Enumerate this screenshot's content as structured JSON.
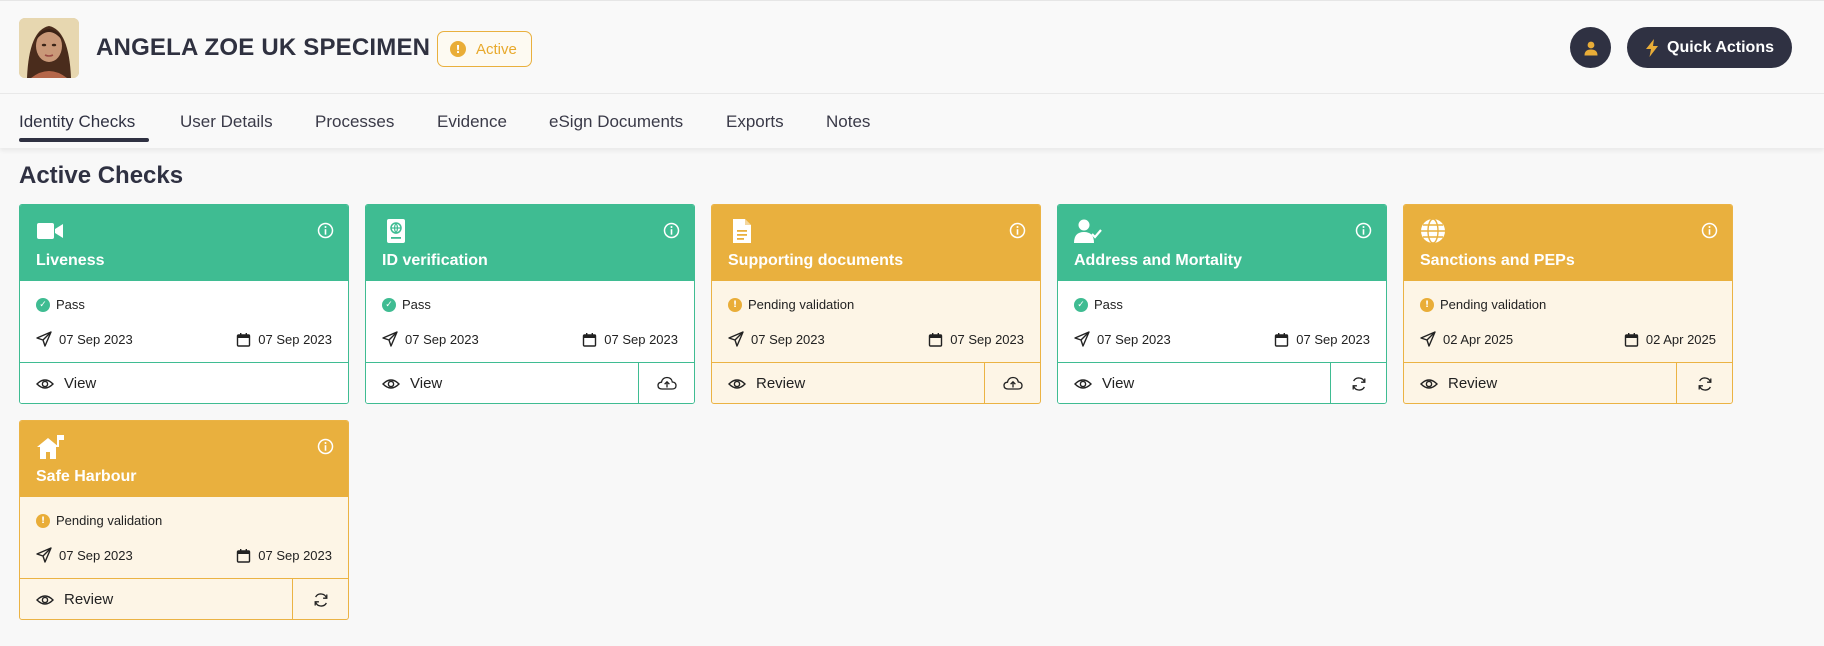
{
  "header": {
    "user_name": "ANGELA ZOE UK SPECIMEN",
    "status": "Active",
    "status_color": "#e9b03e",
    "quick_actions": "Quick Actions"
  },
  "tabs": [
    {
      "label": "Identity Checks",
      "active": true
    },
    {
      "label": "User Details"
    },
    {
      "label": "Processes"
    },
    {
      "label": "Evidence"
    },
    {
      "label": "eSign Documents"
    },
    {
      "label": "Exports"
    },
    {
      "label": "Notes"
    }
  ],
  "section_title": "Active Checks",
  "colors": {
    "pass": "#3fbc92",
    "pending": "#e9b03e",
    "dark": "#2f3142"
  },
  "cards": [
    {
      "title": "Liveness",
      "icon": "video-camera-icon",
      "status": "Pass",
      "sent": "07 Sep 2023",
      "updated": "07 Sep 2023",
      "action": "View"
    },
    {
      "title": "ID verification",
      "icon": "passport-icon",
      "status": "Pass",
      "sent": "07 Sep 2023",
      "updated": "07 Sep 2023",
      "action": "View",
      "side": "upload-icon"
    },
    {
      "title": "Supporting documents",
      "icon": "document-icon",
      "status": "Pending validation",
      "sent": "07 Sep 2023",
      "updated": "07 Sep 2023",
      "action": "Review",
      "side": "upload-icon"
    },
    {
      "title": "Address and Mortality",
      "icon": "user-check-icon",
      "status": "Pass",
      "sent": "07 Sep 2023",
      "updated": "07 Sep 2023",
      "action": "View",
      "side": "refresh-icon"
    },
    {
      "title": "Sanctions and PEPs",
      "icon": "globe-icon",
      "status": "Pending validation",
      "sent": "02 Apr 2025",
      "updated": "02 Apr 2025",
      "action": "Review",
      "side": "refresh-icon"
    },
    {
      "title": "Safe Harbour",
      "icon": "house-flag-icon",
      "status": "Pending validation",
      "sent": "07 Sep 2023",
      "updated": "07 Sep 2023",
      "action": "Review",
      "side": "refresh-icon"
    }
  ]
}
